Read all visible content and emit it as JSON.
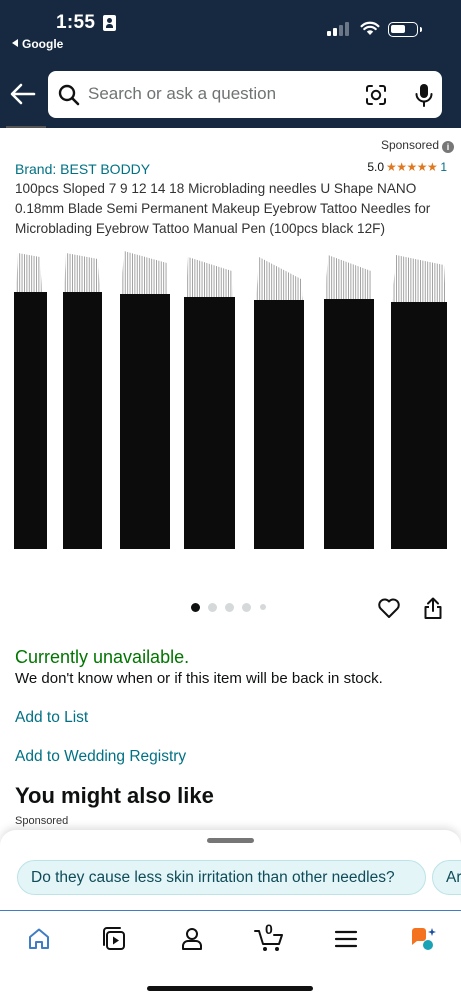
{
  "status_bar": {
    "time": "1:55",
    "back_app": "Google"
  },
  "header": {
    "search_placeholder": "Search or ask a question",
    "icons": [
      "back-arrow-icon",
      "search-icon",
      "camera-lens-icon",
      "microphone-icon"
    ]
  },
  "product": {
    "sponsored_label": "Sponsored",
    "brand": "Brand: BEST BODDY",
    "rating_value": "5.0",
    "stars": "★★★★★",
    "rating_count": "1",
    "title": "100pcs Sloped 7 9 12 14 18 Microblading needles U Shape NANO 0.18mm Blade Semi Permanent Makeup Eyebrow Tattoo Needles for Microblading Eyebrow Tattoo Manual Pen (100pcs black 12F)",
    "image_count": 5,
    "current_image": 1
  },
  "availability": {
    "status": "Currently unavailable.",
    "note": "We don't know when or if this item will be back in stock."
  },
  "actions": {
    "add_to_list": "Add to List",
    "add_to_registry": "Add to Wedding Registry"
  },
  "recommendations": {
    "heading": "You might also like",
    "sponsored_label": "Sponsored"
  },
  "assistant_sheet": {
    "chips": [
      "Do they cause less skin irritation than other needles?",
      "Are"
    ]
  },
  "tab_bar": {
    "tabs": [
      "home-icon",
      "video-icon",
      "account-icon",
      "cart-icon",
      "menu-icon",
      "rufus-icon"
    ],
    "cart_count": "0",
    "active_tab": "home"
  },
  "colors": {
    "header_bg": "#162941",
    "link": "#007185",
    "available_green": "#007600",
    "star": "#de7921",
    "active_tab": "#3f7ec4"
  }
}
